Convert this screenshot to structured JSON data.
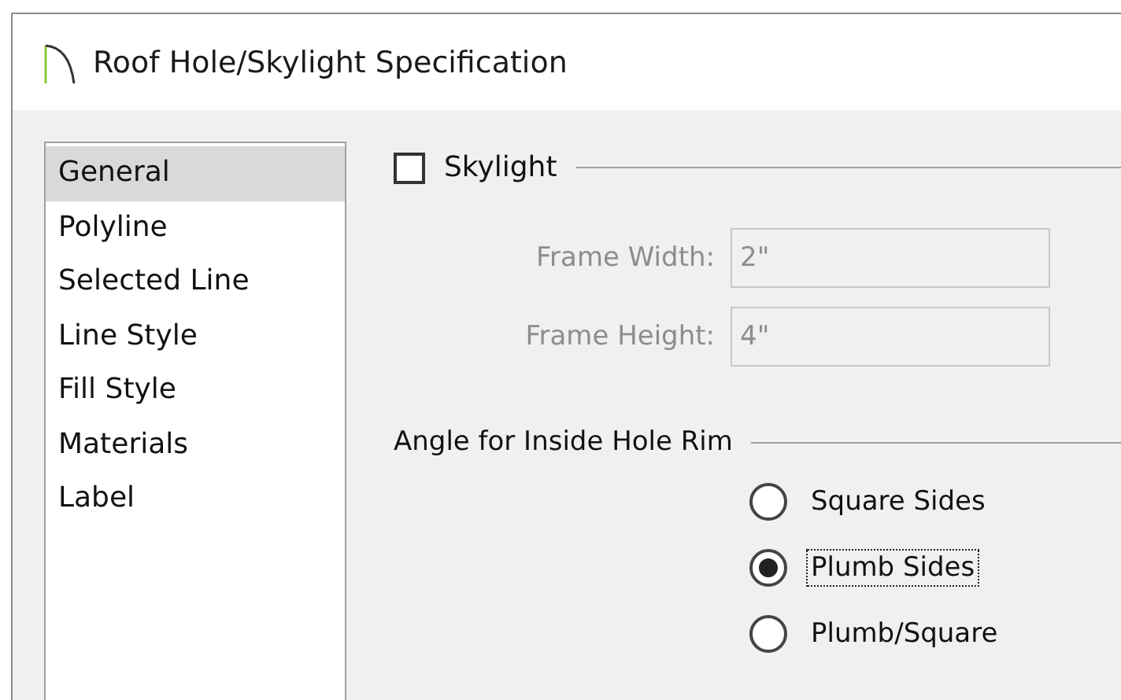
{
  "window": {
    "title": "Roof Hole/Skylight Specification"
  },
  "sidebar": {
    "items": [
      {
        "label": "General",
        "selected": true
      },
      {
        "label": "Polyline",
        "selected": false
      },
      {
        "label": "Selected Line",
        "selected": false
      },
      {
        "label": "Line Style",
        "selected": false
      },
      {
        "label": "Fill Style",
        "selected": false
      },
      {
        "label": "Materials",
        "selected": false
      },
      {
        "label": "Label",
        "selected": false
      }
    ]
  },
  "skylight": {
    "label": "Skylight",
    "checked": false,
    "fields": [
      {
        "label": "Frame Width:",
        "value": "2\"",
        "disabled": true
      },
      {
        "label": "Frame Height:",
        "value": "4\"",
        "disabled": true
      }
    ]
  },
  "angle_group": {
    "label": "Angle for Inside Hole Rim",
    "options": [
      {
        "label": "Square Sides",
        "selected": false,
        "focused": false
      },
      {
        "label": "Plumb Sides",
        "selected": true,
        "focused": true
      },
      {
        "label": "Plumb/Square",
        "selected": false,
        "focused": false
      }
    ]
  }
}
